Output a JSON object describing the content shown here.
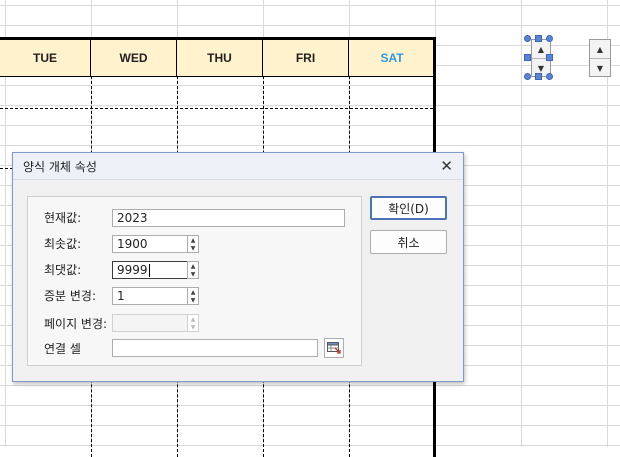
{
  "calendar": {
    "days": [
      {
        "label": "TUE",
        "color": "#222222"
      },
      {
        "label": "WED",
        "color": "#222222"
      },
      {
        "label": "THU",
        "color": "#222222"
      },
      {
        "label": "FRI",
        "color": "#222222"
      },
      {
        "label": "SAT",
        "color": "#2f9be0"
      }
    ],
    "header_bg": "#fff2cc"
  },
  "dialog": {
    "title": "양식 개체 속성",
    "close_icon": "close-icon",
    "fields": {
      "current_value": {
        "label": "현재값:",
        "value": "2023"
      },
      "min_value": {
        "label": "최솟값:",
        "value": "1900"
      },
      "max_value": {
        "label": "최댓값:",
        "value": "9999"
      },
      "increment": {
        "label": "증분 변경:",
        "value": "1"
      },
      "page_change": {
        "label": "페이지 변경:",
        "value": ""
      },
      "linked_cell": {
        "label": "연결 셀",
        "value": ""
      }
    },
    "ok_label": "확인(D)",
    "cancel_label": "취소"
  },
  "colors": {
    "accent": "#4a73b8",
    "selection_handle": "#5b84d6"
  }
}
